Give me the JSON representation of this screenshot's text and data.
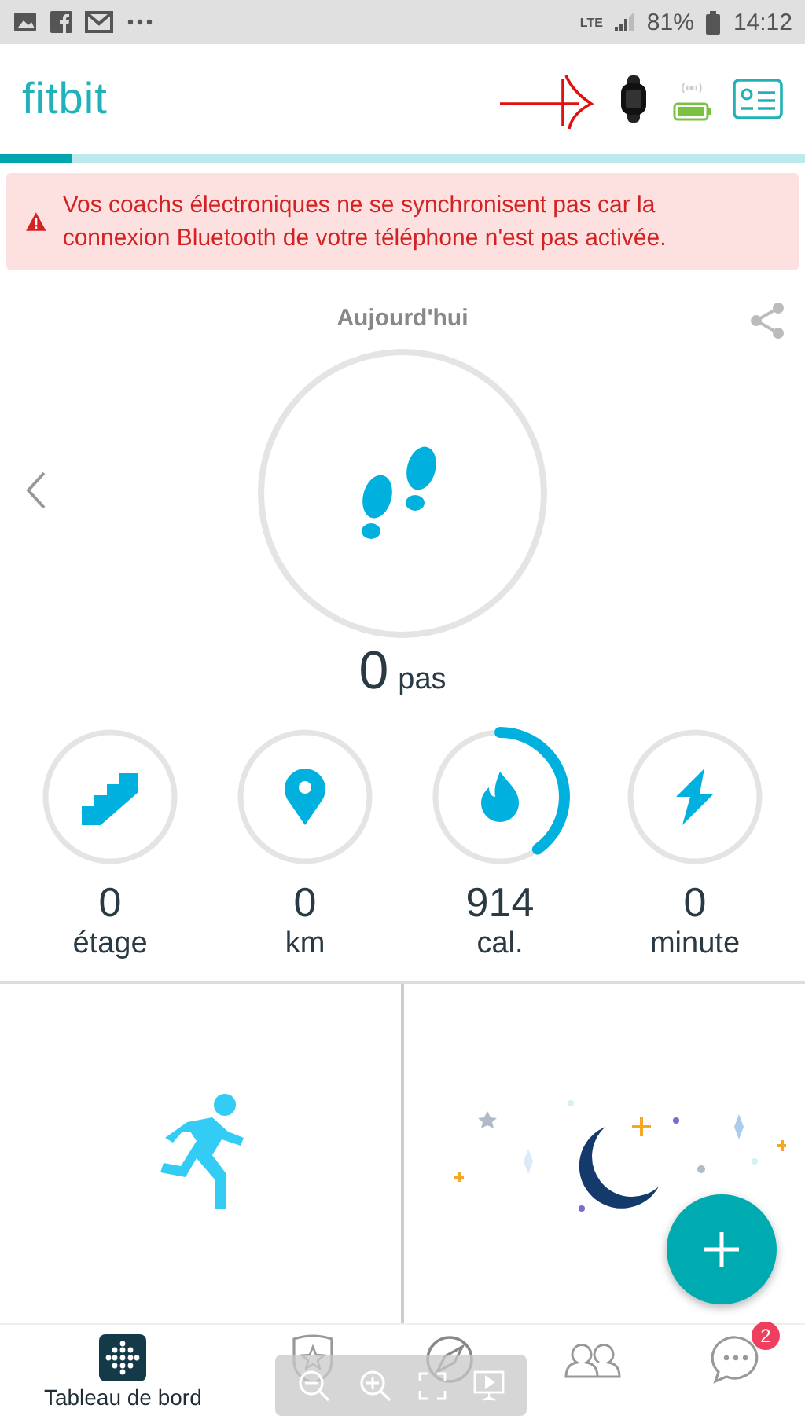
{
  "status_bar": {
    "network": "LTE",
    "battery": "81%",
    "time": "14:12"
  },
  "header": {
    "logo": "fitbit",
    "sync": {
      "level": 0.09
    }
  },
  "alert": {
    "text": "Vos coachs électroniques ne se synchronisent pas car la connexion Bluetooth de votre téléphone n'est pas activée."
  },
  "day": {
    "title": "Aujourd'hui"
  },
  "steps": {
    "value": "0",
    "unit": "pas"
  },
  "stats": [
    {
      "kind": "stairs",
      "value": "0",
      "unit": "étage",
      "progress": false
    },
    {
      "kind": "distance",
      "value": "0",
      "unit": "km",
      "progress": false
    },
    {
      "kind": "calories",
      "value": "914",
      "unit": "cal.",
      "progress": true
    },
    {
      "kind": "minutes",
      "value": "0",
      "unit": "minute",
      "progress": false
    }
  ],
  "tiles": [
    {
      "kind": "run"
    },
    {
      "kind": "sleep"
    }
  ],
  "nav": [
    {
      "kind": "dashboard",
      "label": "Tableau de bord",
      "selected": true
    },
    {
      "kind": "challenges",
      "selected": false
    },
    {
      "kind": "discover",
      "selected": false
    },
    {
      "kind": "community",
      "selected": false
    },
    {
      "kind": "messages",
      "selected": false,
      "badge": "2"
    }
  ]
}
